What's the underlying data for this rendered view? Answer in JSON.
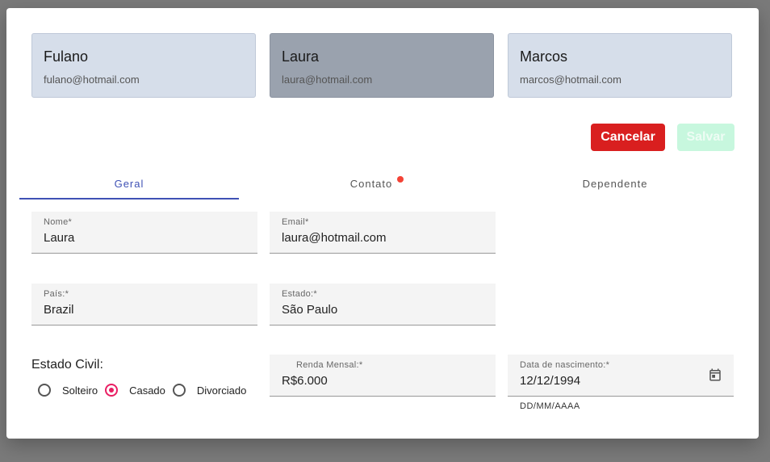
{
  "cards": [
    {
      "name": "Fulano",
      "email": "fulano@hotmail.com"
    },
    {
      "name": "Laura",
      "email": "laura@hotmail.com"
    },
    {
      "name": "Marcos",
      "email": "marcos@hotmail.com"
    }
  ],
  "actions": {
    "cancel_label": "Cancelar",
    "save_label": "Salvar"
  },
  "tabs": [
    {
      "label": "Geral"
    },
    {
      "label": "Contato"
    },
    {
      "label": "Dependente"
    }
  ],
  "form": {
    "nome": {
      "label": "Nome*",
      "value": "Laura"
    },
    "email": {
      "label": "Email*",
      "value": "laura@hotmail.com"
    },
    "pais": {
      "label": "País:*",
      "value": "Brazil"
    },
    "estado": {
      "label": "Estado:*",
      "value": "São Paulo"
    },
    "renda": {
      "label": "Renda Mensal:*",
      "value": "R$6.000"
    },
    "nascimento": {
      "label": "Data de nascimento:*",
      "value": "12/12/1994",
      "hint": "DD/MM/AAAA"
    },
    "estado_civil": {
      "label": "Estado Civil:",
      "options": [
        "Solteiro",
        "Casado",
        "Divorciado"
      ],
      "selected": "Casado"
    }
  },
  "colors": {
    "accent": "#3f51b5",
    "danger": "#d91f1f",
    "radio": "#e91e63",
    "badge": "#f44336"
  }
}
